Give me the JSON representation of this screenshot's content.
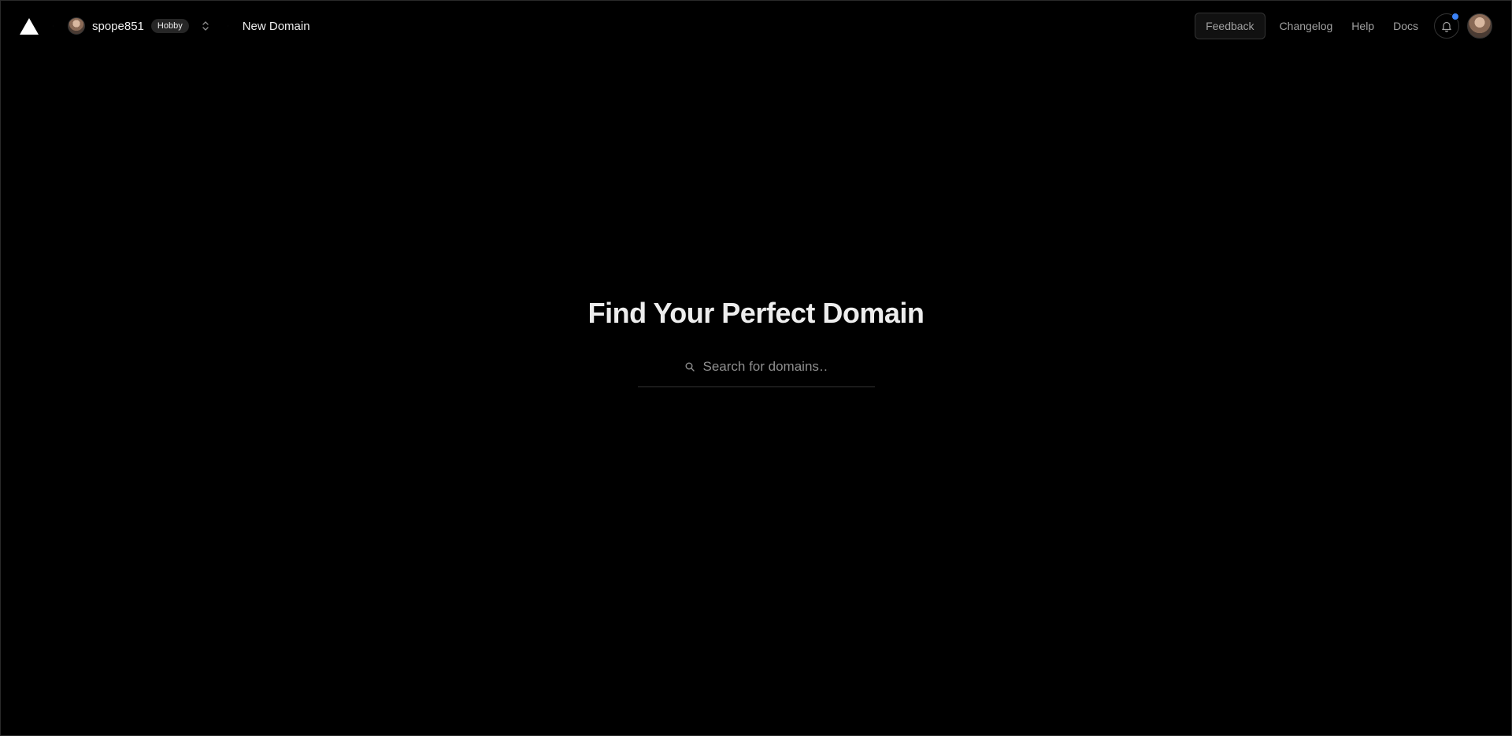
{
  "header": {
    "logo": "triangle-logo-icon",
    "team": {
      "name": "spope851",
      "plan_badge": "Hobby"
    },
    "breadcrumb_current": "New Domain",
    "feedback_label": "Feedback",
    "nav_links": [
      "Changelog",
      "Help",
      "Docs"
    ],
    "notifications_icon": "bell-icon",
    "notification_dot_color": "#3b82f6"
  },
  "main": {
    "title": "Find Your Perfect Domain",
    "search": {
      "placeholder": "Search for domains…",
      "value": ""
    }
  }
}
